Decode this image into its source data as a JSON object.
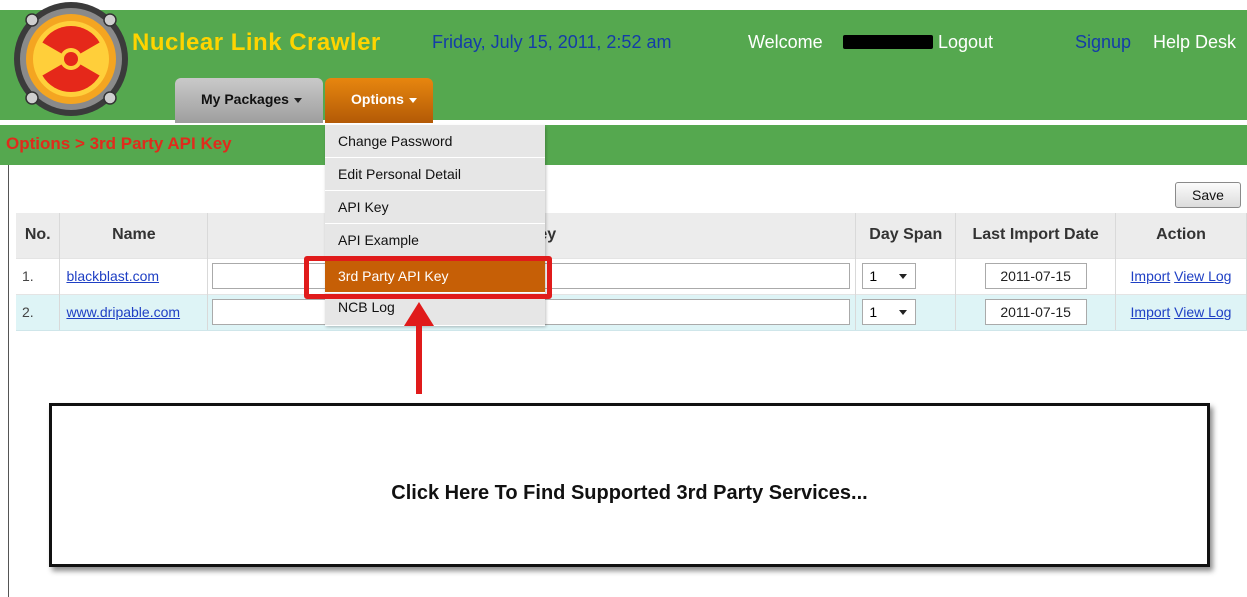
{
  "header": {
    "app_title": "Nuclear Link Crawler",
    "date": "Friday, July 15, 2011, 2:52 am",
    "welcome": "Welcome",
    "logout": "Logout",
    "signup": "Signup",
    "help_desk": "Help Desk"
  },
  "nav": {
    "my_packages": "My Packages",
    "options": "Options"
  },
  "breadcrumb": "Options > 3rd Party API Key",
  "toolbar": {
    "save_label": "Save"
  },
  "table": {
    "headers": {
      "no": "No.",
      "name": "Name",
      "key": "ey",
      "day_span": "Day Span",
      "last_import_date": "Last Import Date",
      "action": "Action"
    },
    "rows": [
      {
        "no": "1.",
        "name": "blackblast.com",
        "key": "",
        "day_span": "1",
        "last_import_date": "2011-07-15",
        "import": "Import",
        "view_log": "View Log"
      },
      {
        "no": "2.",
        "name": "www.dripable.com",
        "key": "",
        "day_span": "1",
        "last_import_date": "2011-07-15",
        "import": "Import",
        "view_log": "View Log"
      }
    ]
  },
  "options_menu": {
    "items": [
      {
        "label": "Change Password"
      },
      {
        "label": "Edit Personal Detail"
      },
      {
        "label": "API Key"
      },
      {
        "label": "API Example"
      },
      {
        "label": "3rd Party API Key",
        "active": true
      },
      {
        "label": "NCB Log"
      }
    ]
  },
  "callout": {
    "text": "Click Here To Find Supported 3rd Party Services..."
  },
  "colors": {
    "header_green": "#55a84f",
    "title_yellow": "#ffd400",
    "menu_orange": "#c65f06",
    "annotation_red": "#e01b1b",
    "link_blue": "#1e3fc4"
  }
}
